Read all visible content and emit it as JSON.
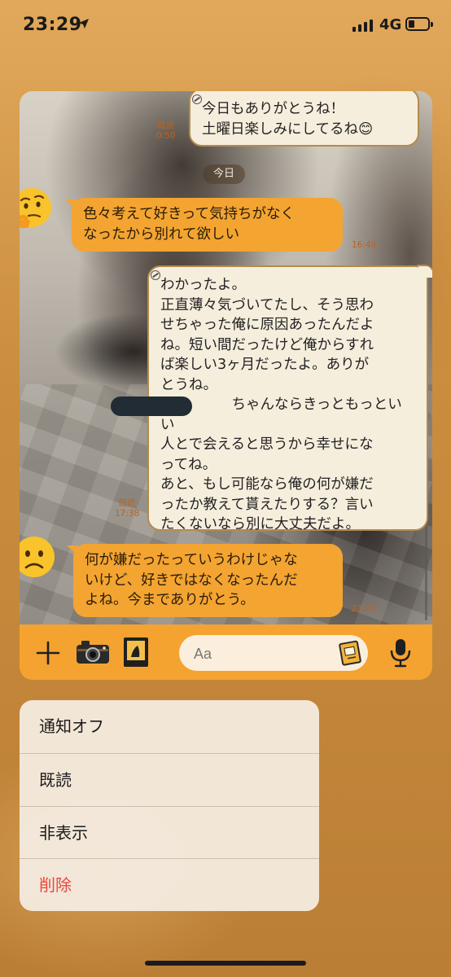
{
  "status_bar": {
    "time": "23:29",
    "network": "4G",
    "signal_bars": 4,
    "battery_level": 0.25
  },
  "chat": {
    "date_divider": "今日",
    "messages": [
      {
        "sender": "me",
        "lines": [
          "今日もありがとうね！",
          "土曜日楽しみにしてるね😊"
        ],
        "read_label": "既読",
        "time": "0:50"
      },
      {
        "sender": "them",
        "avatar": "thinking-face",
        "lines": [
          "色々考えて好きって気持ちがなく",
          "なったから別れて欲しい"
        ],
        "time": "16:48"
      },
      {
        "sender": "me",
        "lines": [
          "わかったよ。",
          "正直薄々気づいてたし、そう思わ",
          "せちゃった俺に原因あったんだよ",
          "ね。短い間だったけど俺からすれ",
          "ば楽しい3ヶ月だったよ。ありが",
          "とうね。",
          "　　　　　ちゃんならきっともっといい",
          "人とで会えると思うから幸せにな",
          "ってね。",
          "あと、もし可能なら俺の何が嫌だ",
          "ったか教えて貰えたりする？言い",
          "たくないなら別に大丈夫だよ。"
        ],
        "read_label": "既読",
        "time": "17:38"
      },
      {
        "sender": "them",
        "avatar": "frowning-face",
        "lines": [
          "何が嫌だったっていうわけじゃな",
          "いけど、好きではなくなったんだ",
          "よね。今までありがとう。"
        ],
        "time": "23:29"
      }
    ]
  },
  "input_bar": {
    "placeholder": "Aa"
  },
  "context_menu": {
    "items": [
      {
        "label": "通知オフ",
        "destructive": false
      },
      {
        "label": "既読",
        "destructive": false
      },
      {
        "label": "非表示",
        "destructive": false
      },
      {
        "label": "削除",
        "destructive": true
      }
    ]
  },
  "colors": {
    "accent_orange": "#f3a431",
    "my_bubble": "#f6eedd",
    "delete_red": "#e8463b"
  }
}
